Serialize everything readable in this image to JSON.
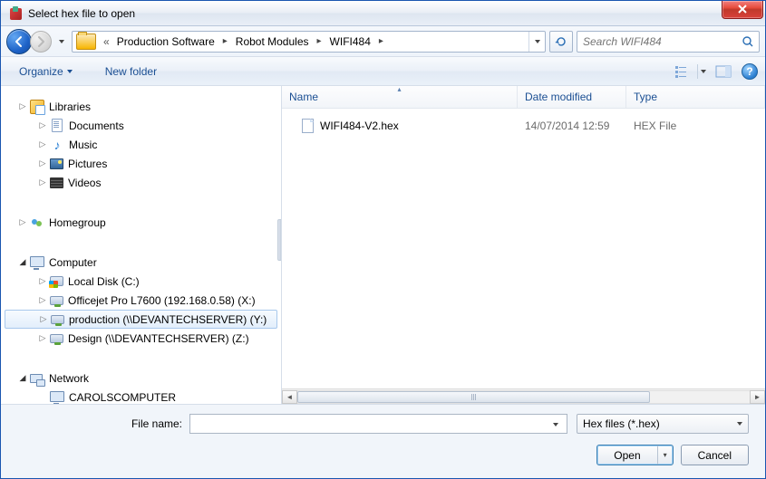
{
  "title": "Select hex file to open",
  "breadcrumb": {
    "chevrons": "«",
    "items": [
      "Production Software",
      "Robot Modules",
      "WIFI484"
    ]
  },
  "search": {
    "placeholder": "Search WIFI484"
  },
  "toolbar": {
    "organize": "Organize",
    "newfolder": "New folder"
  },
  "columns": {
    "name": "Name",
    "date": "Date modified",
    "type": "Type"
  },
  "files": [
    {
      "name": "WIFI484-V2.hex",
      "date": "14/07/2014 12:59",
      "type": "HEX File"
    }
  ],
  "tree": {
    "libraries": "Libraries",
    "documents": "Documents",
    "music": "Music",
    "pictures": "Pictures",
    "videos": "Videos",
    "homegroup": "Homegroup",
    "computer": "Computer",
    "localdisk": "Local Disk (C:)",
    "officejet": "Officejet Pro L7600 (192.168.0.58) (X:)",
    "production": "production (\\\\DEVANTECHSERVER) (Y:)",
    "design": "Design (\\\\DEVANTECHSERVER) (Z:)",
    "network": "Network",
    "carols": "CAROLSCOMPUTER"
  },
  "footer": {
    "filename_label": "File name:",
    "filename_value": "",
    "filter": "Hex files (*.hex)",
    "open": "Open",
    "cancel": "Cancel"
  }
}
